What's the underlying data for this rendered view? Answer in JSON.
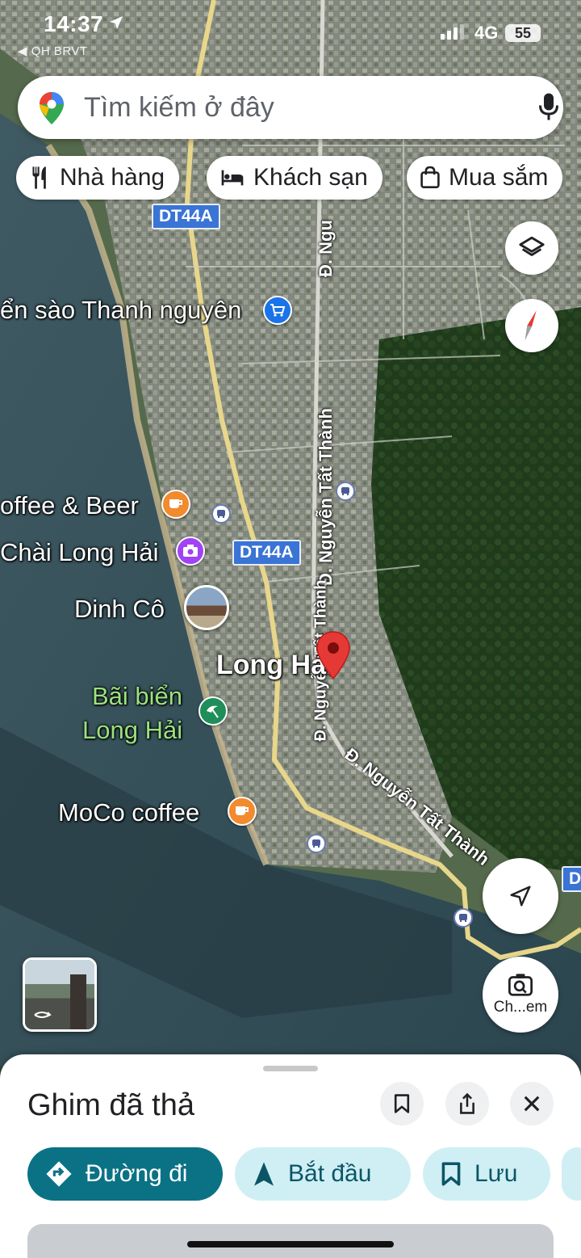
{
  "status_bar": {
    "time": "14:37",
    "back_app": "◀ QH BRVT",
    "network": "4G",
    "battery": "55"
  },
  "search": {
    "placeholder": "Tìm kiếm ở đây"
  },
  "chips": [
    {
      "label": "Nhà hàng",
      "icon": "restaurant-icon"
    },
    {
      "label": "Khách sạn",
      "icon": "hotel-icon"
    },
    {
      "label": "Mua sắm",
      "icon": "shopping-bag-icon"
    }
  ],
  "map": {
    "road_shields": [
      "DT44A",
      "DT44A",
      "D"
    ],
    "streets": [
      "Đ. Nguyễn Tất Thành",
      "Đ. Nguyễn Tất Thành",
      "Đ. Nguyễn Tất Thành",
      "Đ. Ngu"
    ],
    "places": {
      "shop": "ển sào Thanh nguyên",
      "cafe1": "offee & Beer",
      "photo": "Chài Long Hải",
      "dinh": "Dinh Cô",
      "town": "Long Hải",
      "beach_line1": "Bãi biển",
      "beach_line2": "Long Hải",
      "cafe2": "MoCo coffee"
    },
    "lens_label": "Ch...em",
    "colors": {
      "pin": "#e53935",
      "shop": "#1a73e8",
      "cafe": "#f28a2e",
      "photo": "#a142f4",
      "beach": "#1e8e5a"
    }
  },
  "sheet": {
    "title": "Ghim đã thả",
    "actions": [
      {
        "label": "Đường đi",
        "icon": "directions-icon"
      },
      {
        "label": "Bắt đầu",
        "icon": "navigation-arrow-icon"
      },
      {
        "label": "Lưu",
        "icon": "bookmark-icon"
      }
    ]
  }
}
